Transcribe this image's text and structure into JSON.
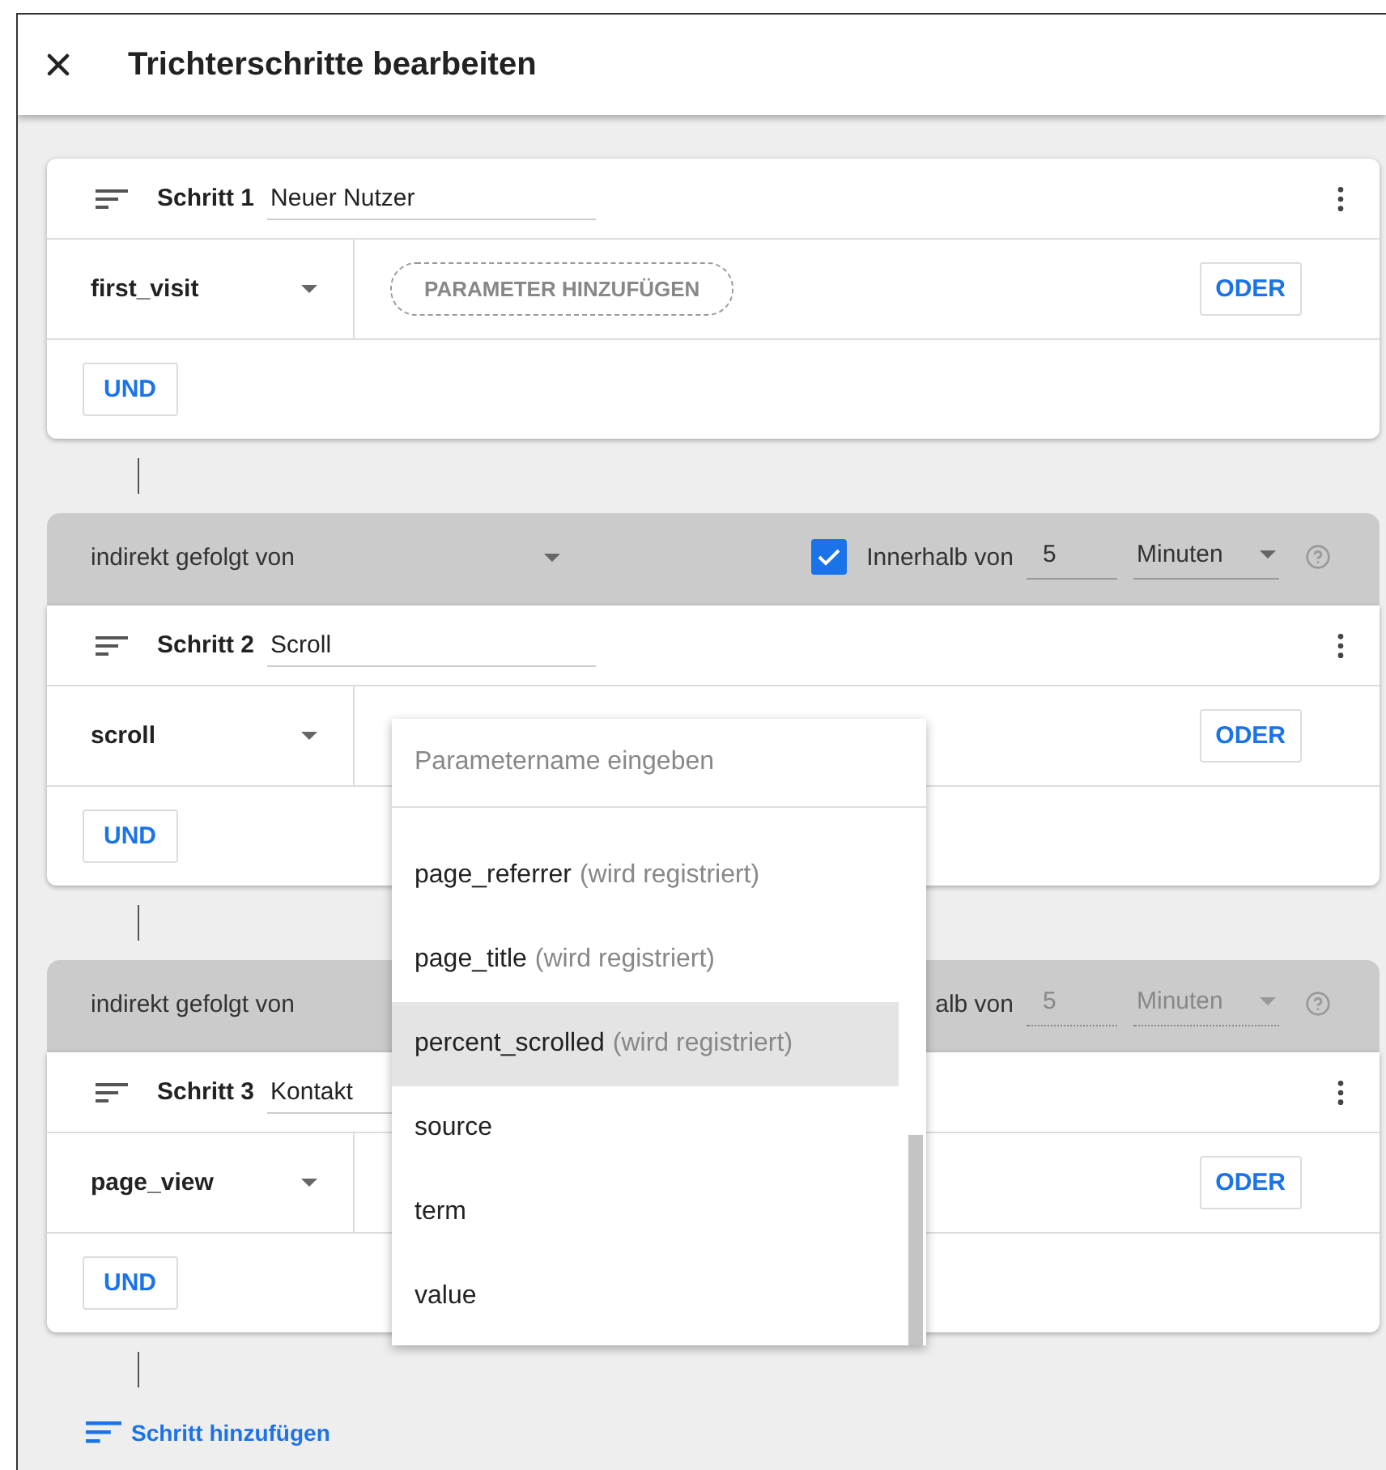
{
  "dialog": {
    "title": "Trichterschritte bearbeiten"
  },
  "steps": [
    {
      "label": "Schritt 1",
      "name": "Neuer Nutzer",
      "event": "first_visit",
      "add_parameter": "PARAMETER HINZUFÜGEN",
      "or_button": "ODER",
      "and_button": "UND"
    },
    {
      "condition": {
        "type": "indirekt gefolgt von",
        "checked": true,
        "within_label": "Innerhalb von",
        "value": "5",
        "unit": "Minuten",
        "disabled": false
      },
      "label": "Schritt 2",
      "name": "Scroll",
      "event": "scroll",
      "or_button": "ODER",
      "and_button": "UND"
    },
    {
      "condition": {
        "type": "indirekt gefolgt von",
        "within_label": "alb von",
        "value": "5",
        "unit": "Minuten",
        "disabled": true
      },
      "label": "Schritt 3",
      "name": "Kontakt",
      "event": "page_view",
      "or_button": "ODER",
      "and_button": "UND"
    }
  ],
  "add_step": "Schritt hinzufügen",
  "param_dropdown": {
    "placeholder": "Parametername eingeben",
    "items": [
      {
        "name": "page_referrer",
        "hint": "(wird registriert)",
        "highlighted": false
      },
      {
        "name": "page_title",
        "hint": "(wird registriert)",
        "highlighted": false
      },
      {
        "name": "percent_scrolled",
        "hint": "(wird registriert)",
        "highlighted": true
      },
      {
        "name": "source",
        "highlighted": false
      },
      {
        "name": "term",
        "highlighted": false
      },
      {
        "name": "value",
        "highlighted": false
      }
    ]
  }
}
